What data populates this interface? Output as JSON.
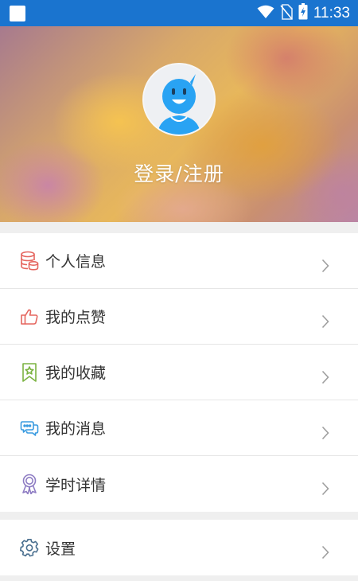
{
  "status_bar": {
    "time": "11:33",
    "icons": [
      "notification-square-icon",
      "wifi-icon",
      "no-sim-icon",
      "battery-charging-icon"
    ]
  },
  "header": {
    "login_label": "登录/注册",
    "avatar_icon": "user-avatar-icon"
  },
  "menu": {
    "items": [
      {
        "label": "个人信息",
        "icon": "database-icon",
        "color": "#e5665f"
      },
      {
        "label": "我的点赞",
        "icon": "thumbs-up-icon",
        "color": "#e5665f"
      },
      {
        "label": "我的收藏",
        "icon": "bookmark-star-icon",
        "color": "#7cb342"
      },
      {
        "label": "我的消息",
        "icon": "chat-bubbles-icon",
        "color": "#3a9be0"
      },
      {
        "label": "学时详情",
        "icon": "award-ribbon-icon",
        "color": "#8e7cc3"
      }
    ],
    "settings": {
      "label": "设置",
      "icon": "gear-icon",
      "color": "#4a6f8f"
    }
  },
  "colors": {
    "status_bar": "#1a74cf",
    "avatar_face": "#29a3f3",
    "chevron": "#9e9e9e"
  }
}
